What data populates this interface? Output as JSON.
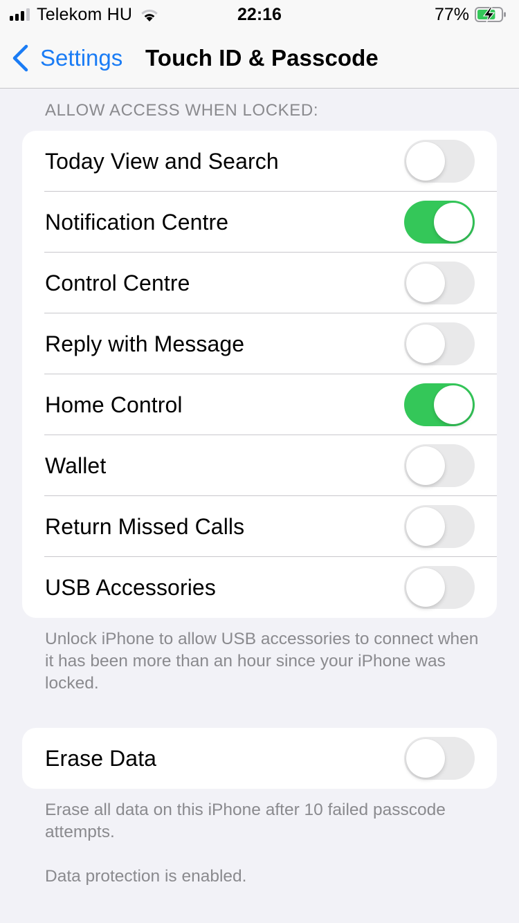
{
  "status_bar": {
    "carrier": "Telekom HU",
    "time": "22:16",
    "battery_percent": "77%",
    "battery_level": 0.77,
    "battery_charging": true,
    "signal_bars_active": 3,
    "signal_bars_total": 4,
    "icons": [
      "signal-icon",
      "wifi-icon",
      "battery-charging-icon"
    ]
  },
  "nav": {
    "back_label": "Settings",
    "back_icon": "chevron-left-icon",
    "title": "Touch ID & Passcode"
  },
  "colors": {
    "accent": "#1a7cf5",
    "toggle_on": "#34c759",
    "toggle_off": "#e9e9ea",
    "background": "#f2f2f7",
    "secondary_text": "#8a8a8e"
  },
  "locked_access": {
    "header": "ALLOW ACCESS WHEN LOCKED:",
    "items": [
      {
        "label": "Today View and Search",
        "on": false
      },
      {
        "label": "Notification Centre",
        "on": true
      },
      {
        "label": "Control Centre",
        "on": false
      },
      {
        "label": "Reply with Message",
        "on": false
      },
      {
        "label": "Home Control",
        "on": true
      },
      {
        "label": "Wallet",
        "on": false
      },
      {
        "label": "Return Missed Calls",
        "on": false
      },
      {
        "label": "USB Accessories",
        "on": false
      }
    ],
    "footer": "Unlock iPhone to allow USB accessories to connect when it has been more than an hour since your iPhone was locked."
  },
  "erase": {
    "label": "Erase Data",
    "on": false,
    "footer_line1": "Erase all data on this iPhone after 10 failed passcode attempts.",
    "footer_line2": "Data protection is enabled."
  }
}
